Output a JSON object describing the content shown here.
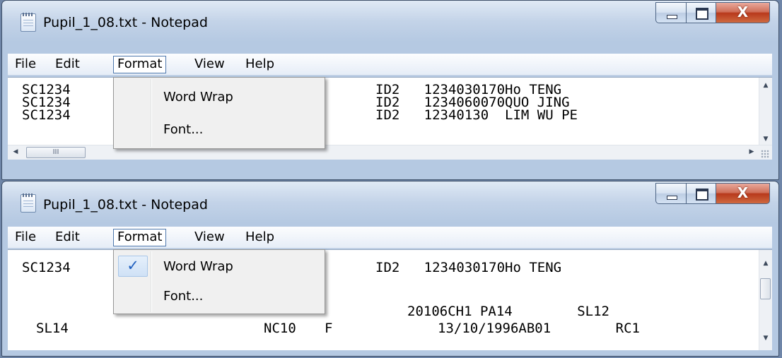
{
  "windows": [
    {
      "title": "Pupil_1_08.txt - Notepad",
      "menu": [
        "File",
        "Edit",
        "Format",
        "View",
        "Help"
      ],
      "lines_left": [
        "SC1234",
        "SC1234",
        "SC1234"
      ],
      "lines_right": [
        "ID2   1234030170Ho TENG",
        "ID2   1234060070QUO JING",
        "ID2   12340130  LIM WU PE"
      ],
      "dropdown": [
        {
          "label": "Word Wrap",
          "checked": false
        },
        {
          "label": "Font...",
          "checked": false
        }
      ],
      "hscroll_thumb": "III"
    },
    {
      "title": "Pupil_1_08.txt - Notepad",
      "menu": [
        "File",
        "Edit",
        "Format",
        "View",
        "Help"
      ],
      "line1_left": "SC1234",
      "line1_right": "ID2   1234030170Ho TENG",
      "line2_right": "20106CH1 PA14        SL12",
      "line3_left": "SL14",
      "line3_mid": "NC10",
      "line3_mid2": "F",
      "line3_right": "13/10/1996AB01        RC1",
      "dropdown": [
        {
          "label": "Word Wrap",
          "checked": true
        },
        {
          "label": "Font...",
          "checked": false
        }
      ],
      "check_glyph": "✓"
    }
  ],
  "caption": {
    "minimize_icon": "minimize-icon",
    "maximize_icon": "maximize-icon",
    "close_label": "X"
  }
}
